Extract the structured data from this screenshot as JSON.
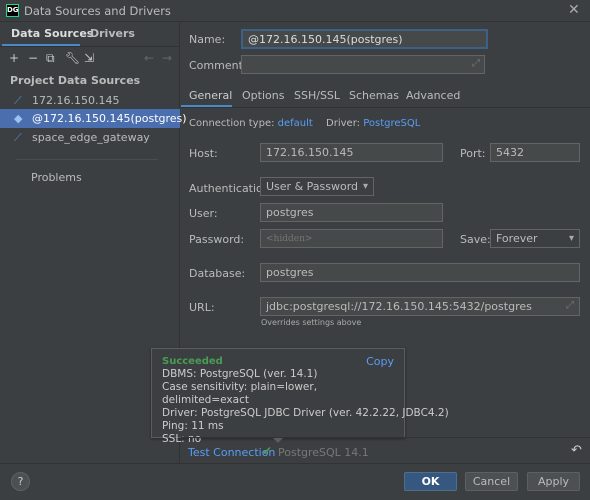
{
  "window": {
    "title": "Data Sources and Drivers",
    "app_icon": "DG"
  },
  "left": {
    "tabs": [
      "Data Sources",
      "Drivers"
    ],
    "section": "Project Data Sources",
    "items": [
      "172.16.150.145",
      "@172.16.150.145(postgres)",
      "space_edge_gateway"
    ],
    "problems": "Problems"
  },
  "form": {
    "name_label": "Name:",
    "name_value": "@172.16.150.145(postgres)",
    "comment_label": "Comment:",
    "comment_value": "",
    "tabs": [
      "General",
      "Options",
      "SSH/SSL",
      "Schemas",
      "Advanced"
    ],
    "conn_type_label": "Connection type:",
    "conn_type": "default",
    "driver_label": "Driver:",
    "driver": "PostgreSQL",
    "host_label": "Host:",
    "host": "172.16.150.145",
    "port_label": "Port:",
    "port": "5432",
    "auth_label": "Authentication:",
    "auth": "User & Password",
    "user_label": "User:",
    "user": "postgres",
    "password_label": "Password:",
    "password_placeholder": "<hidden>",
    "save_label": "Save:",
    "save": "Forever",
    "database_label": "Database:",
    "database": "postgres",
    "url_label": "URL:",
    "url": "jdbc:postgresql://172.16.150.145:5432/postgres",
    "url_hint": "Overrides settings above"
  },
  "popup": {
    "status": "Succeeded",
    "copy": "Copy",
    "lines": [
      "DBMS: PostgreSQL (ver. 14.1)",
      "Case sensitivity: plain=lower, delimited=exact",
      "Driver: PostgreSQL JDBC Driver (ver. 42.2.22, JDBC4.2)",
      "Ping: 11 ms",
      "SSL: no"
    ]
  },
  "test": {
    "link": "Test Connection",
    "result": "PostgreSQL 14.1"
  },
  "buttons": {
    "help": "?",
    "ok": "OK",
    "cancel": "Cancel",
    "apply": "Apply"
  },
  "colors": {
    "accent": "#4a88c7",
    "success": "#499c54",
    "link": "#589df6",
    "selection": "#4b6eaf"
  }
}
